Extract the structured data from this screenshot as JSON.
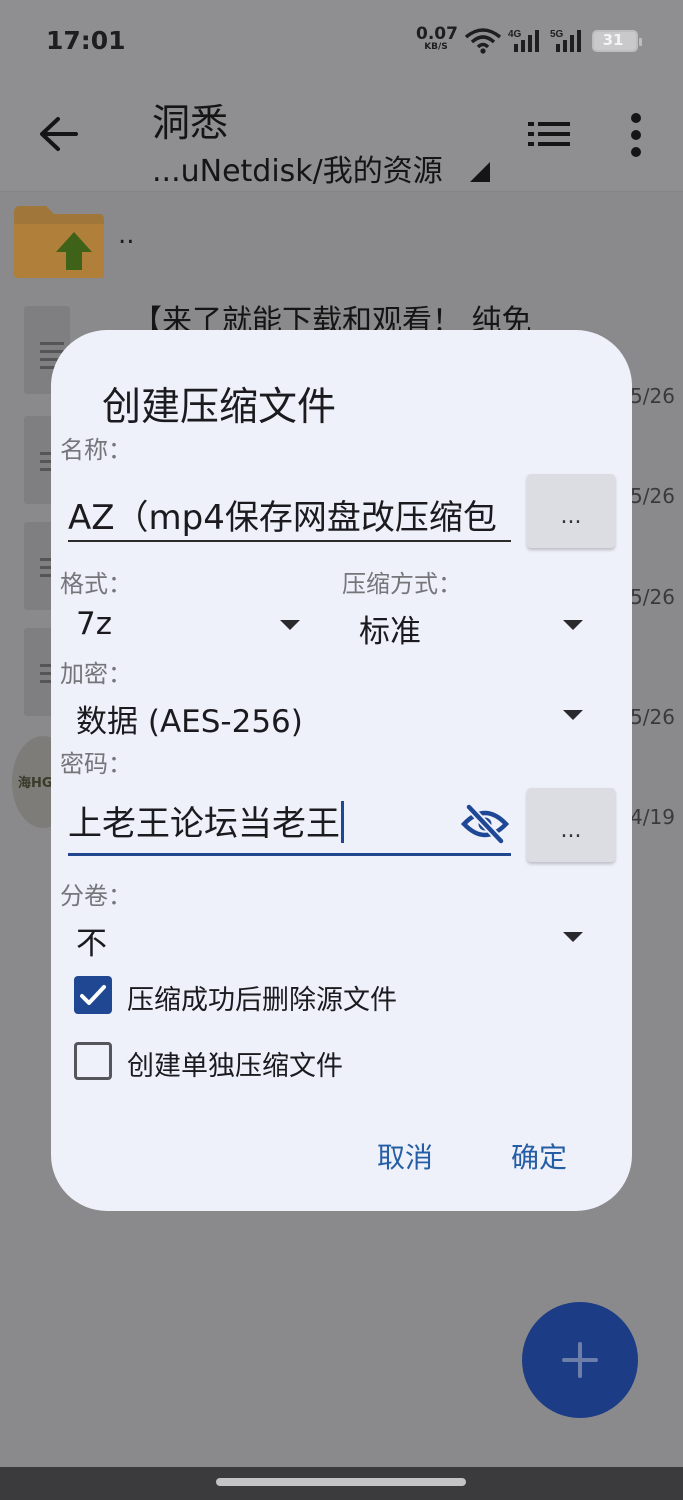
{
  "status_bar": {
    "time": "17:01",
    "net_speed": "0.07",
    "net_speed_unit": "KB/S",
    "sig1_label": "4G",
    "sig2_label": "5G",
    "battery": "31"
  },
  "toolbar": {
    "title": "洞悉",
    "path": "...uNetdisk/我的资源"
  },
  "file_list": {
    "parent_label": "..",
    "first_file_name": "【来了就能下载和观看！ 纯免",
    "dates": [
      "5/26",
      "5/26",
      "5/26",
      "5/26",
      "4/19"
    ],
    "thumb_label": "海HGAC"
  },
  "dialog": {
    "title": "创建压缩文件",
    "name_label": "名称：",
    "name_value": "AZ（mp4保存网盘改压缩包",
    "browse_label": "...",
    "format_label": "格式：",
    "format_value": "7z",
    "method_label": "压缩方式：",
    "method_value": "标准",
    "encrypt_label": "加密：",
    "encrypt_value": "数据 (AES-256)",
    "password_label": "密码：",
    "password_value": "上老王论坛当老王",
    "split_label": "分卷：",
    "split_value": "不",
    "delete_source_label": "压缩成功后删除源文件",
    "delete_source_checked": true,
    "separate_label": "创建单独压缩文件",
    "separate_checked": false,
    "cancel_label": "取消",
    "ok_label": "确定"
  },
  "colors": {
    "accent": "#1f4792",
    "button_text": "#255ea4",
    "dialog_bg": "#eef0fa",
    "scrim": "#8e8e90"
  }
}
